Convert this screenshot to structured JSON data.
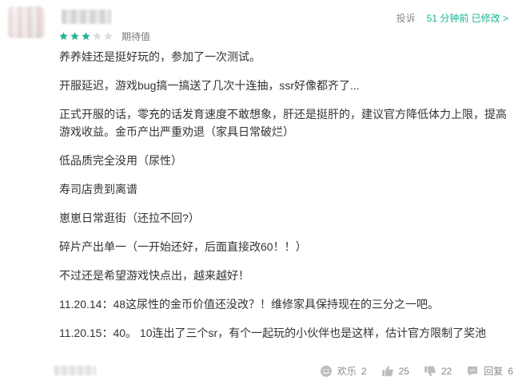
{
  "review": {
    "rating": {
      "filled_stars": 3,
      "total_stars": 5,
      "label": "期待值"
    },
    "header_actions": {
      "report": "投诉",
      "edited_time": "51 分钟前 已修改 >"
    },
    "paragraphs": [
      "养养娃还是挺好玩的，参加了一次测试。",
      "开服延迟，游戏bug搞一搞送了几次十连抽，ssr好像都齐了...",
      "正式开服的话，零充的话发育速度不敢想象，肝还是挺肝的，建议官方降低体力上限，提高游戏收益。金币产出严重劝退（家具日常破烂）",
      "低品质完全没用（尿性）",
      "寿司店贵到离谱",
      "崽崽日常逛街（还拉不回?）",
      "碎片产出单一（一开始还好，后面直接改60！！）",
      "不过还是希望游戏快点出，越来越好！",
      "11.20.14：48这尿性的金币价值还没改？！维修家具保持现在的三分之一吧。",
      "11.20.15：40。 10连出了三个sr，有个一起玩的小伙伴也是这样，估计官方限制了奖池"
    ],
    "footer_actions": {
      "happy": {
        "label": "欢乐",
        "count": "2"
      },
      "like": {
        "count": "25"
      },
      "dislike": {
        "count": "22"
      },
      "reply": {
        "label": "回复",
        "count": "6"
      }
    },
    "colors": {
      "accent": "#19b394",
      "star_filled": "#2bb39a",
      "star_empty": "#dddddd"
    }
  }
}
